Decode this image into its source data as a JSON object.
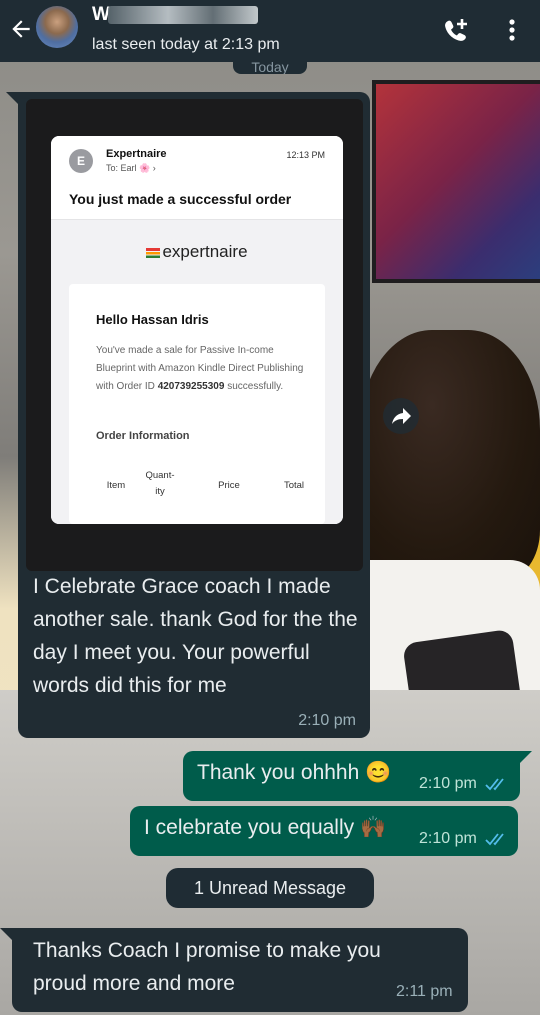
{
  "header": {
    "contact_name": "W",
    "last_seen": "last seen today at 2:13 pm",
    "back_icon": "arrow-left-icon",
    "call_icon": "add-call-icon",
    "menu_icon": "more-vert-icon"
  },
  "date_chip": "Today",
  "messages": [
    {
      "direction": "incoming",
      "image": {
        "sender_initial": "E",
        "sender_name": "Expertnaire",
        "to_line": "To: Earl",
        "time": "12:13 PM",
        "subject": "You just made a successful order",
        "brand": "expertnaire",
        "greeting": "Hello Hassan Idris",
        "body_text": "You've made a sale for Passive In-come Blueprint with Amazon Kindle Direct Publishing with Order ID",
        "order_id": "420739255309",
        "body_suffix": "successfully.",
        "order_information": "Order Information",
        "table_headers": [
          "Item",
          "Quant-ity",
          "Price",
          "Total"
        ]
      },
      "text": "I Celebrate Grace coach I made another sale. thank God for the the day I meet you. Your powerful words did this for me",
      "time": "2:10 pm"
    },
    {
      "direction": "outgoing",
      "text": "Thank you ohhhh",
      "emoji": "😊",
      "time": "2:10 pm",
      "status": "read"
    },
    {
      "direction": "outgoing",
      "text": "I celebrate you equally",
      "emoji": "🙌🏾",
      "time": "2:10 pm",
      "status": "read"
    },
    {
      "direction": "incoming",
      "text": "Thanks Coach I promise to make you proud more and more",
      "time": "2:11 pm"
    }
  ],
  "unread_banner": "1 Unread Message",
  "colors": {
    "header": "#1f2c34",
    "incoming_bubble": "#202c33",
    "outgoing_bubble": "#005c4b",
    "read_ticks": "#53bdeb"
  }
}
